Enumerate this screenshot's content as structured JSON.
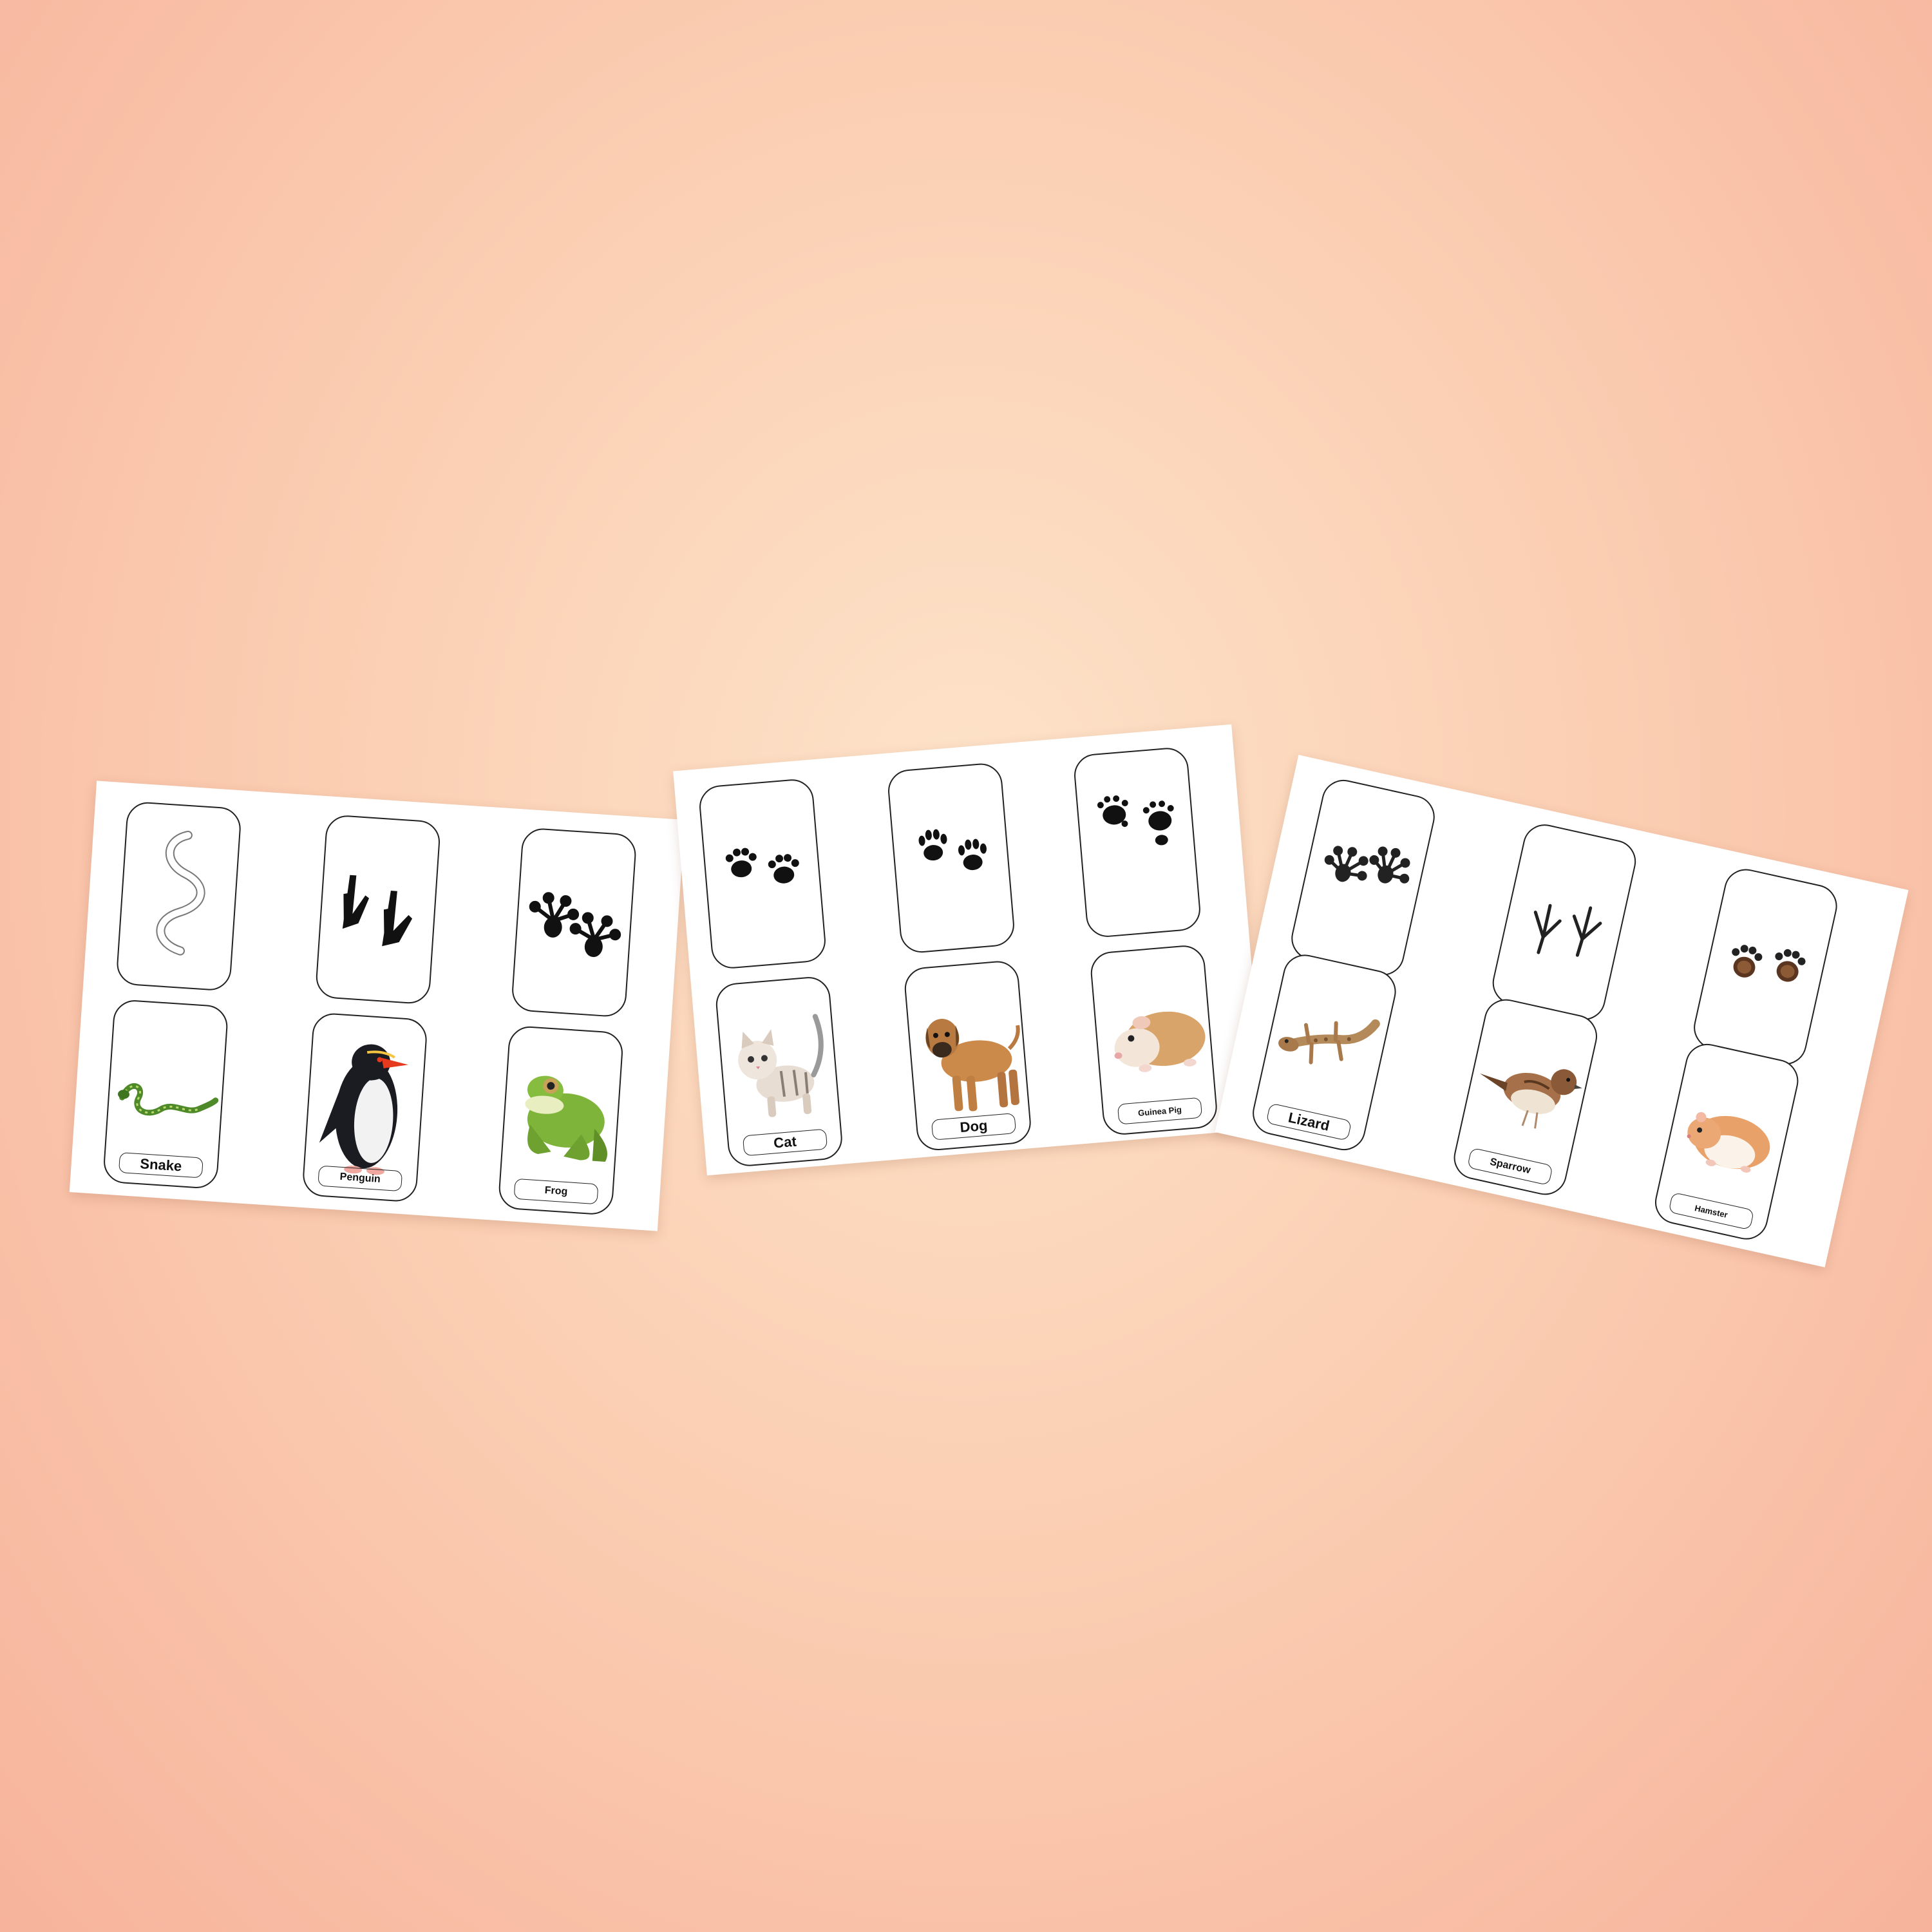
{
  "background": {
    "color_center": "#fde3c9",
    "color_edge": "#f7b39c"
  },
  "sheets": [
    {
      "cards": [
        {
          "type": "track",
          "animal": "snake",
          "icon": "snake-track-icon"
        },
        {
          "type": "track",
          "animal": "penguin",
          "icon": "penguin-track-icon"
        },
        {
          "type": "track",
          "animal": "frog",
          "icon": "frog-track-icon"
        },
        {
          "type": "animal",
          "label": "Snake",
          "icon": "snake-icon"
        },
        {
          "type": "animal",
          "label": "Penguin",
          "icon": "penguin-icon"
        },
        {
          "type": "animal",
          "label": "Frog",
          "icon": "frog-icon"
        }
      ]
    },
    {
      "cards": [
        {
          "type": "track",
          "animal": "cat",
          "icon": "paw-print-icon"
        },
        {
          "type": "track",
          "animal": "dog",
          "icon": "paw-print-icon"
        },
        {
          "type": "track",
          "animal": "guinea-pig",
          "icon": "paw-print-icon"
        },
        {
          "type": "animal",
          "label": "Cat",
          "icon": "cat-icon"
        },
        {
          "type": "animal",
          "label": "Dog",
          "icon": "dog-icon"
        },
        {
          "type": "animal",
          "label": "Guinea Pig",
          "icon": "guinea-pig-icon"
        }
      ]
    },
    {
      "cards": [
        {
          "type": "track",
          "animal": "lizard",
          "icon": "lizard-track-icon"
        },
        {
          "type": "track",
          "animal": "sparrow",
          "icon": "bird-track-icon"
        },
        {
          "type": "track",
          "animal": "hamster",
          "icon": "paw-print-icon"
        },
        {
          "type": "animal",
          "label": "Lizard",
          "icon": "lizard-icon"
        },
        {
          "type": "animal",
          "label": "Sparrow",
          "icon": "sparrow-icon"
        },
        {
          "type": "animal",
          "label": "Hamster",
          "icon": "hamster-icon"
        }
      ]
    }
  ]
}
